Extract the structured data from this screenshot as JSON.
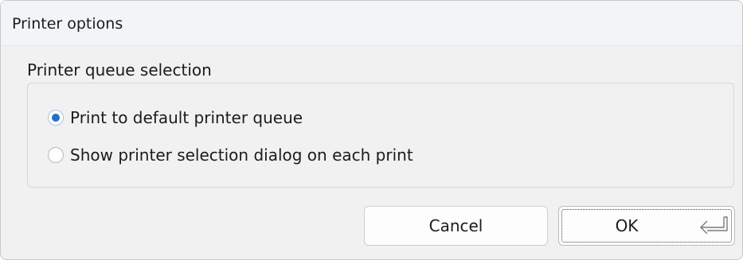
{
  "window": {
    "title": "Printer options"
  },
  "group": {
    "label": "Printer queue selection",
    "options": [
      {
        "label": "Print to default printer queue",
        "selected": true
      },
      {
        "label": "Show printer selection dialog on each print",
        "selected": false
      }
    ]
  },
  "buttons": {
    "cancel_label": "Cancel",
    "ok_label": "OK",
    "ok_icon": "enter-key-icon"
  },
  "colors": {
    "accent": "#1f6fd0",
    "dialog_background": "#f1f1f1",
    "titlebar_background": "#f2f4f8"
  }
}
